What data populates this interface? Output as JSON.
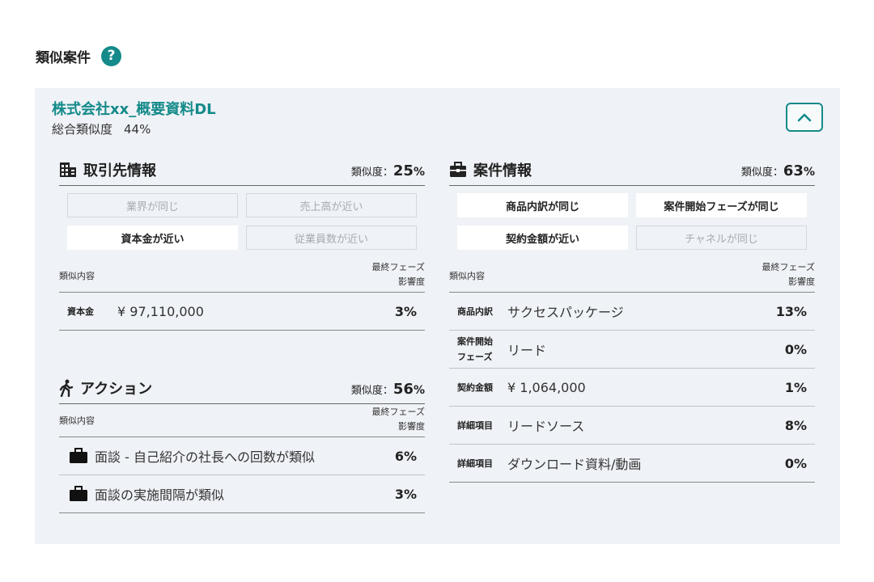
{
  "header": {
    "title": "類似案件",
    "help": "?"
  },
  "case": {
    "title": "株式会社xx_概要資料DL",
    "overall_label": "総合類似度",
    "overall_value": "44%"
  },
  "client": {
    "title": "取引先情報",
    "sim_label": "類似度：",
    "sim_value": "25",
    "sim_unit": "%",
    "tags": [
      {
        "label": "業界が同じ",
        "active": false
      },
      {
        "label": "売上高が近い",
        "active": false
      },
      {
        "label": "資本金が近い",
        "active": true
      },
      {
        "label": "従業員数が近い",
        "active": false
      }
    ],
    "col_label": "類似内容",
    "col_right_1": "最終フェーズ",
    "col_right_2": "影響度",
    "rows": [
      {
        "key": "資本金",
        "value": "¥ 97,110,000",
        "pct": "3%"
      }
    ]
  },
  "deal": {
    "title": "案件情報",
    "sim_label": "類似度：",
    "sim_value": "63",
    "sim_unit": "%",
    "tags": [
      {
        "label": "商品内訳が同じ",
        "active": true
      },
      {
        "label": "案件開始フェーズが同じ",
        "active": true
      },
      {
        "label": "契約金額が近い",
        "active": true
      },
      {
        "label": "チャネルが同じ",
        "active": false
      }
    ],
    "col_label": "類似内容",
    "col_right_1": "最終フェーズ",
    "col_right_2": "影響度",
    "rows": [
      {
        "key1": "商品内訳",
        "key2": "",
        "value": "サクセスパッケージ",
        "pct": "13%"
      },
      {
        "key1": "案件開始",
        "key2": "フェーズ",
        "value": "リード",
        "pct": "0%"
      },
      {
        "key1": "契約金額",
        "key2": "",
        "value": "¥ 1,064,000",
        "pct": "1%"
      },
      {
        "key1": "詳細項目",
        "key2": "",
        "value": "リードソース",
        "pct": "8%"
      },
      {
        "key1": "詳細項目",
        "key2": "",
        "value": "ダウンロード資料/動画",
        "pct": "0%"
      }
    ]
  },
  "action": {
    "title": "アクション",
    "sim_label": "類似度：",
    "sim_value": "56",
    "sim_unit": "%",
    "col_label": "類似内容",
    "col_right_1": "最終フェーズ",
    "col_right_2": "影響度",
    "rows": [
      {
        "value": "面談 - 自己紹介の社長への回数が類似",
        "pct": "6%"
      },
      {
        "value": "面談の実施間隔が類似",
        "pct": "3%"
      }
    ]
  },
  "colors": {
    "accent": "#148a8a",
    "panel_bg": "#eff2f6"
  },
  "icons": {
    "help": "question-circle-icon",
    "collapse": "chevron-up-icon",
    "client": "building-icon",
    "deal": "briefcase-icon",
    "action": "walking-person-icon",
    "row": "bag-icon"
  }
}
